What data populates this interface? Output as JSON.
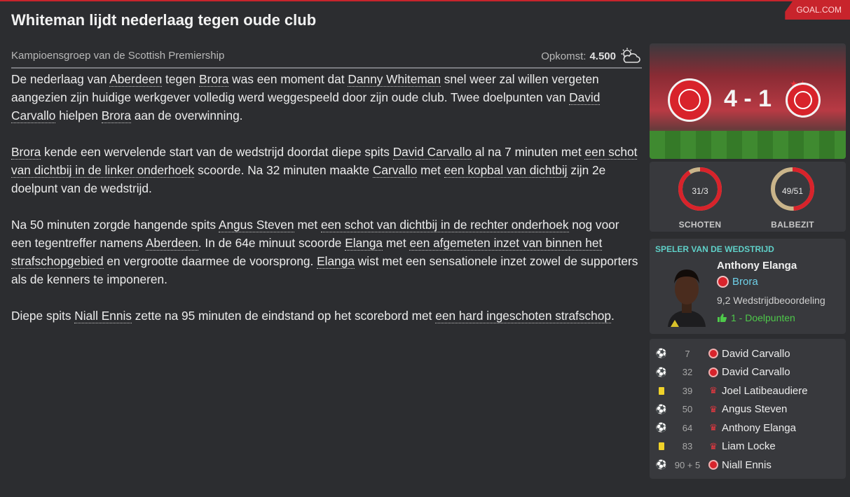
{
  "source": "GOAL.COM",
  "headline": "Whiteman lijdt nederlaag tegen oude club",
  "meta": {
    "competition": "Kampioensgroep van de Scottish Premiership",
    "attendance_label": "Opkomst:",
    "attendance_value": "4.500",
    "weather_icon": "partly-cloudy-icon"
  },
  "article": {
    "p1": [
      {
        "t": "De nederlaag van "
      },
      {
        "t": "Aberdeen",
        "link": true
      },
      {
        "t": " tegen "
      },
      {
        "t": "Brora",
        "link": true
      },
      {
        "t": " was een moment dat "
      },
      {
        "t": "Danny Whiteman",
        "link": true
      },
      {
        "t": " snel weer zal willen vergeten aangezien zijn huidige werkgever volledig werd weggespeeld door zijn oude club. Twee doelpunten van "
      },
      {
        "t": "David Carvallo",
        "link": true
      },
      {
        "t": " hielpen "
      },
      {
        "t": "Brora",
        "link": true
      },
      {
        "t": " aan de overwinning."
      }
    ],
    "p2": [
      {
        "t": "Brora",
        "link": true
      },
      {
        "t": " kende een wervelende start van de wedstrijd doordat diepe spits "
      },
      {
        "t": "David Carvallo",
        "link": true
      },
      {
        "t": " al na 7 minuten met "
      },
      {
        "t": "een schot van dichtbij in de linker onderhoek",
        "link": true
      },
      {
        "t": " scoorde. Na 32 minuten maakte "
      },
      {
        "t": "Carvallo",
        "link": true
      },
      {
        "t": " met "
      },
      {
        "t": "een kopbal van dichtbij",
        "link": true
      },
      {
        "t": " zijn 2e doelpunt van de wedstrijd."
      }
    ],
    "p3": [
      {
        "t": "Na 50 minuten zorgde hangende spits "
      },
      {
        "t": "Angus Steven",
        "link": true
      },
      {
        "t": " met "
      },
      {
        "t": "een schot van dichtbij in de rechter onderhoek",
        "link": true
      },
      {
        "t": " nog voor een tegentreffer namens "
      },
      {
        "t": "Aberdeen",
        "link": true
      },
      {
        "t": ". In de 64e minuut scoorde "
      },
      {
        "t": "Elanga",
        "link": true
      },
      {
        "t": " met "
      },
      {
        "t": "een afgemeten inzet van binnen het strafschopgebied",
        "link": true
      },
      {
        "t": " en vergrootte daarmee de voorsprong. "
      },
      {
        "t": "Elanga",
        "link": true
      },
      {
        "t": " wist met een sensationele inzet zowel de supporters als de kenners te imponeren."
      }
    ],
    "p4": [
      {
        "t": "Diepe spits "
      },
      {
        "t": "Niall Ennis",
        "link": true
      },
      {
        "t": " zette na 95 minuten de eindstand op het scorebord met "
      },
      {
        "t": "een hard ingeschoten strafschop",
        "link": true
      },
      {
        "t": "."
      }
    ]
  },
  "match": {
    "score": "4 - 1",
    "home_crest_icon": "brora-rangers-crest-icon",
    "away_crest_icon": "aberdeen-crest-icon"
  },
  "stats": {
    "shots": {
      "label": "SCHOTEN",
      "value": "31/3",
      "home_share": 0.91
    },
    "possession": {
      "label": "BALBEZIT",
      "value": "49/51",
      "home_share": 0.49
    },
    "home_color": "#d8232b",
    "away_color": "#c9b48a"
  },
  "potm": {
    "title": "SPELER VAN DE WEDSTRIJD",
    "name": "Anthony Elanga",
    "club": "Brora",
    "rating": "9,2",
    "rating_label": "Wedstrijdbeoordeling",
    "goals": "1 - Doelpunten"
  },
  "events": [
    {
      "type": "goal",
      "minute": "7",
      "team": "home",
      "player": "David Carvallo"
    },
    {
      "type": "goal",
      "minute": "32",
      "team": "home",
      "player": "David Carvallo"
    },
    {
      "type": "yellow",
      "minute": "39",
      "team": "away",
      "player": "Joel Latibeaudiere"
    },
    {
      "type": "goal",
      "minute": "50",
      "team": "away",
      "player": "Angus Steven"
    },
    {
      "type": "goal",
      "minute": "64",
      "team": "away",
      "player": "Anthony Elanga"
    },
    {
      "type": "yellow",
      "minute": "83",
      "team": "away",
      "player": "Liam Locke"
    },
    {
      "type": "goal",
      "minute": "90 + 5",
      "team": "home",
      "player": "Niall Ennis"
    }
  ]
}
